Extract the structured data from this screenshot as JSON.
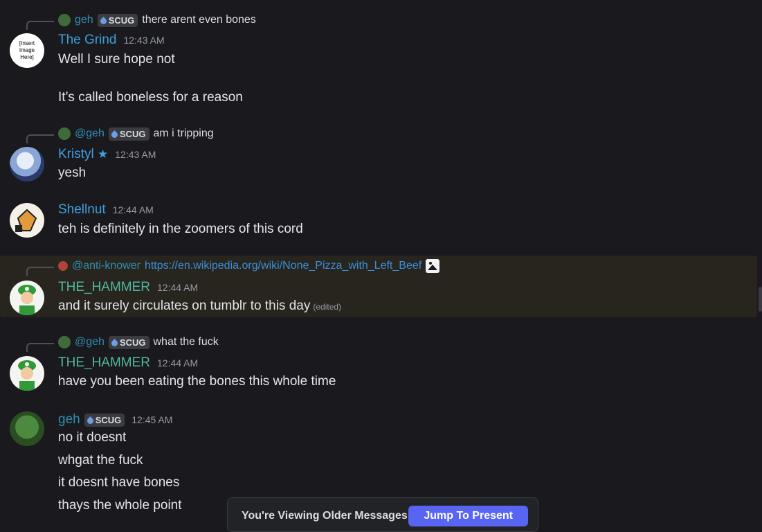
{
  "messages": [
    {
      "reply": {
        "name": "geh",
        "tag": "SCUG",
        "text": "there arent even bones"
      },
      "author": "The Grind",
      "time": "12:43 AM",
      "avatar_text": "[Insert Image Here]",
      "lines": [
        "Well I sure hope not",
        "It’s called boneless for a reason"
      ]
    },
    {
      "reply": {
        "name": "@geh",
        "tag": "SCUG",
        "text": "am i tripping"
      },
      "author": "Kristyl",
      "author_star": "★",
      "time": "12:43 AM",
      "lines": [
        "yesh"
      ]
    },
    {
      "author": "Shellnut",
      "time": "12:44 AM",
      "lines": [
        "teh is definitely in the zoomers of this cord"
      ]
    },
    {
      "reply": {
        "name": "@anti-knower",
        "link": "https://en.wikipedia.org/wiki/None_Pizza_with_Left_Beef"
      },
      "author": "THE_HAMMER",
      "time": "12:44 AM",
      "lines": [
        "and it surely circulates on tumblr to this day"
      ],
      "edited": "(edited)"
    },
    {
      "reply": {
        "name": "@geh",
        "tag": "SCUG",
        "text": "what the fuck"
      },
      "author": "THE_HAMMER",
      "time": "12:44 AM",
      "lines": [
        "have you been eating the bones this whole time"
      ]
    },
    {
      "author": "geh",
      "tag": "SCUG",
      "time": "12:45 AM",
      "lines": [
        "no it doesnt",
        "whgat the fuck",
        "it doesnt have bones",
        "thays the whole point"
      ]
    }
  ],
  "banner": {
    "text": "You're Viewing Older Messages",
    "button": "Jump To Present"
  },
  "colors": {
    "background": "#1a1a1e",
    "accent": "#5865f2",
    "highlight": "#28251f",
    "name_blue": "#3f9fe0",
    "name_teal": "#4fb8a0"
  }
}
